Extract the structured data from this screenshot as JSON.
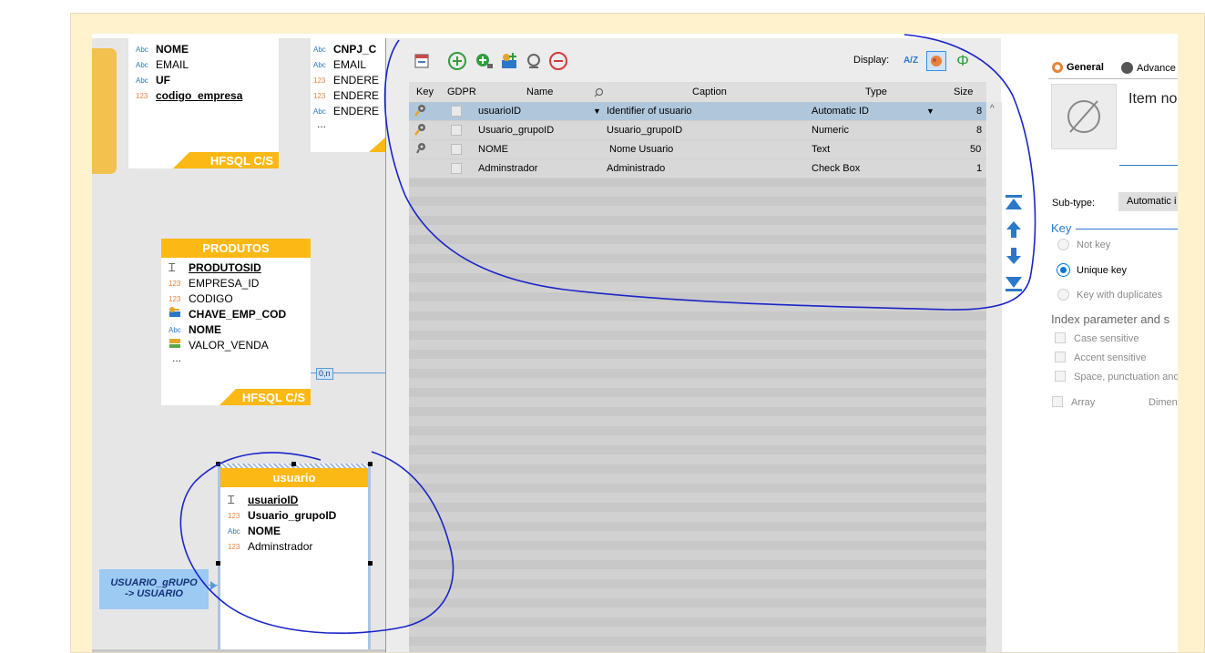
{
  "diagram": {
    "tables": [
      {
        "id": "empresa",
        "fields": [
          {
            "type": "Abc",
            "name": "NOME",
            "bold": true,
            "underline": false
          },
          {
            "type": "Abc",
            "name": "EMAIL",
            "bold": false,
            "underline": false
          },
          {
            "type": "Abc",
            "name": "UF",
            "bold": true,
            "underline": false
          },
          {
            "type": "123",
            "name": "codigo_empresa",
            "bold": true,
            "underline": true
          }
        ],
        "footer": "HFSQL C/S"
      },
      {
        "id": "cliente",
        "fields": [
          {
            "type": "Abc",
            "name": "CNPJ_C",
            "bold": true,
            "underline": false
          },
          {
            "type": "Abc",
            "name": "EMAIL",
            "bold": false,
            "underline": false
          },
          {
            "type": "123",
            "name": "ENDERE",
            "bold": false,
            "underline": false
          },
          {
            "type": "123",
            "name": "ENDERE",
            "bold": false,
            "underline": false
          },
          {
            "type": "Abc",
            "name": "ENDERE",
            "bold": false,
            "underline": false
          }
        ],
        "ellipsis": "..."
      },
      {
        "id": "produtos",
        "title": "PRODUTOS",
        "fields": [
          {
            "type": "Id",
            "name": "PRODUTOSID",
            "bold": true,
            "underline": true
          },
          {
            "type": "123",
            "name": "EMPRESA_ID",
            "bold": false,
            "underline": false
          },
          {
            "type": "123",
            "name": "CODIGO",
            "bold": false,
            "underline": false
          },
          {
            "type": "key",
            "name": "CHAVE_EMP_COD",
            "bold": true,
            "underline": false
          },
          {
            "type": "Abc",
            "name": "NOME",
            "bold": true,
            "underline": false
          },
          {
            "type": "cur",
            "name": "VALOR_VENDA",
            "bold": false,
            "underline": false
          }
        ],
        "ellipsis": "...",
        "footer": "HFSQL C/S",
        "link_label": "0,n"
      },
      {
        "id": "usuario",
        "title": "usuario",
        "fields": [
          {
            "type": "Id",
            "name": "usuarioID",
            "bold": true,
            "underline": true
          },
          {
            "type": "123",
            "name": "Usuario_grupoID",
            "bold": true,
            "underline": false
          },
          {
            "type": "Abc",
            "name": "NOME",
            "bold": true,
            "underline": false
          },
          {
            "type": "123",
            "name": "Adminstrador",
            "bold": false,
            "underline": false
          }
        ]
      }
    ],
    "relation_label": "USUARIO_gRUPO\n-> USUARIO"
  },
  "panel": {
    "display_label": "Display:",
    "toolbar_icons": [
      "table-icon",
      "add-item-icon",
      "add-items-icon",
      "add-key-icon",
      "search-item-icon",
      "remove-item-icon"
    ],
    "display_icons": [
      "sort-az-icon",
      "display-icons-icon",
      "display-phi-icon"
    ],
    "columns": [
      "Key",
      "GDPR",
      "Name",
      "Caption",
      "Type",
      "Size"
    ],
    "rows": [
      {
        "key": true,
        "name": "usuarioID",
        "caption": "Identifier of usuario",
        "type": "Automatic ID",
        "size": "8",
        "selected": true
      },
      {
        "key": true,
        "name": "Usuario_grupoID",
        "caption": "Usuario_grupoID",
        "type": "Numeric",
        "size": "8",
        "selected": false
      },
      {
        "key": true,
        "name": "NOME",
        "caption": "Nome Usuario",
        "type": "Text",
        "size": "50",
        "selected": false
      },
      {
        "key": false,
        "name": "Adminstrador",
        "caption": "Administrado",
        "type": "Check Box",
        "size": "1",
        "selected": false
      }
    ]
  },
  "properties": {
    "tab_general": "General",
    "tab_advanced": "Advance",
    "item_name_label": "Item no",
    "subtype_label": "Sub-type:",
    "subtype_value": "Automatic i",
    "key_section": "Key",
    "key_options": [
      {
        "label": "Not key",
        "selected": false
      },
      {
        "label": "Unique key",
        "selected": true
      },
      {
        "label": "Key with duplicates",
        "selected": false
      }
    ],
    "index_section": "Index parameter and s",
    "index_options": [
      "Case sensitive",
      "Accent sensitive",
      "Space, punctuation and"
    ],
    "array_label": "Array",
    "dimension_label": "Dimen"
  },
  "colors": {
    "table_header": "#fcb814",
    "selected_row": "#b0c7db",
    "annotation_pen": "#1a25c8",
    "accent_blue": "#0078d7"
  }
}
